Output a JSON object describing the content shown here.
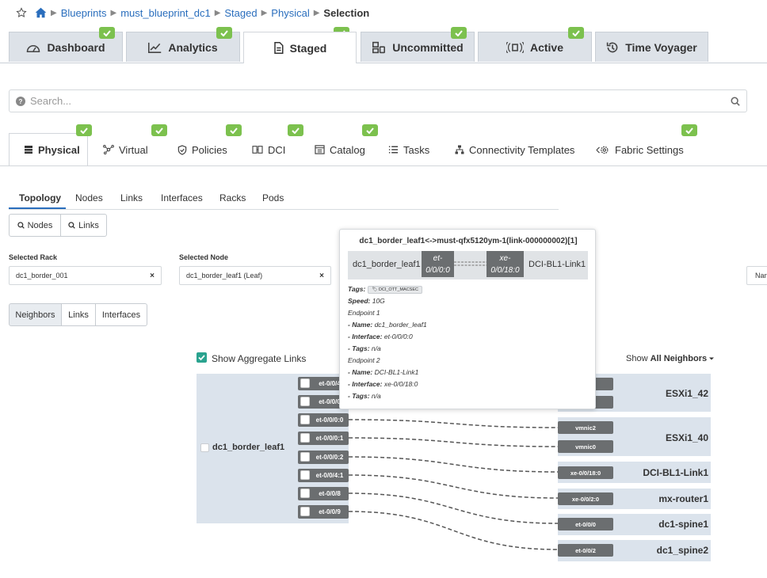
{
  "breadcrumb": {
    "items": [
      "Blueprints",
      "must_blueprint_dc1",
      "Staged",
      "Physical"
    ],
    "current": "Selection"
  },
  "top_tabs": [
    {
      "label": "Dashboard"
    },
    {
      "label": "Analytics"
    },
    {
      "label": "Staged"
    },
    {
      "label": "Uncommitted"
    },
    {
      "label": "Active"
    },
    {
      "label": "Time Voyager"
    }
  ],
  "search": {
    "placeholder": "Search..."
  },
  "sub_tabs": [
    {
      "label": "Physical"
    },
    {
      "label": "Virtual"
    },
    {
      "label": "Policies"
    },
    {
      "label": "DCI"
    },
    {
      "label": "Catalog"
    },
    {
      "label": "Tasks"
    },
    {
      "label": "Connectivity Templates"
    },
    {
      "label": "Fabric Settings"
    }
  ],
  "topology_tabs": [
    "Topology",
    "Nodes",
    "Links",
    "Interfaces",
    "Racks",
    "Pods"
  ],
  "find_buttons": {
    "nodes": "Nodes",
    "links": "Links"
  },
  "filters": {
    "rack_label": "Selected Rack",
    "rack_value": "dc1_border_001",
    "node_label": "Selected Node",
    "node_value": "dc1_border_leaf1 (Leaf)",
    "clear": "×",
    "partial": "Nan"
  },
  "view_tabs": [
    "Neighbors",
    "Links",
    "Interfaces"
  ],
  "aggregate": {
    "label": "Show Aggregate Links",
    "checked": true
  },
  "show_neighbors": {
    "prefix": "Show",
    "value": "All Neighbors"
  },
  "tooltip": {
    "title": "dc1_border_leaf1<->must-qfx5120ym-1(link-000000002)[1]",
    "left_node": "dc1_border_leaf1",
    "left_iface_a": "et-",
    "left_iface_b": "0/0/0:0",
    "right_iface_a": "xe-",
    "right_iface_b": "0/0/18:0",
    "right_node": "DCI-BL1-Link1",
    "tags_label": "Tags:",
    "tag": "DCI_OTT_MACSEC",
    "speed_label": "Speed:",
    "speed": "10G",
    "endpoint1": "Endpoint 1",
    "ep1_name_label": "- Name:",
    "ep1_name": "dc1_border_leaf1",
    "ep1_iface_label": "- Interface:",
    "ep1_iface": "et-0/0/0:0",
    "ep1_tags_label": "- Tags:",
    "ep1_tags": "n/a",
    "endpoint2": "Endpoint 2",
    "ep2_name_label": "- Name:",
    "ep2_name": "DCI-BL1-Link1",
    "ep2_iface_label": "- Interface:",
    "ep2_iface": "xe-0/0/18:0",
    "ep2_tags_label": "- Tags:",
    "ep2_tags": "n/a"
  },
  "topology": {
    "node": "dc1_border_leaf1",
    "ports": [
      "et-0/0/4",
      "et-0/0/0",
      "et-0/0/0:0",
      "et-0/0/0:1",
      "et-0/0/0:2",
      "et-0/0/4:1",
      "et-0/0/8",
      "et-0/0/9"
    ],
    "neighbors": [
      {
        "name": "ESXi1_42",
        "ports": [
          "",
          ""
        ]
      },
      {
        "name": "ESXi1_40",
        "ports": [
          "vmnic2",
          "vmnic0"
        ]
      },
      {
        "name": "DCI-BL1-Link1",
        "ports": [
          "xe-0/0/18:0"
        ]
      },
      {
        "name": "mx-router1",
        "ports": [
          "xe-0/0/2:0"
        ]
      },
      {
        "name": "dc1-spine1",
        "ports": [
          "et-0/0/0"
        ]
      },
      {
        "name": "dc1_spine2",
        "ports": [
          "et-0/0/2"
        ]
      }
    ]
  },
  "colors": {
    "accent": "#2a6ebd",
    "check": "#7cc14e",
    "port": "#6b6e70",
    "panel": "#dbe3ec"
  }
}
